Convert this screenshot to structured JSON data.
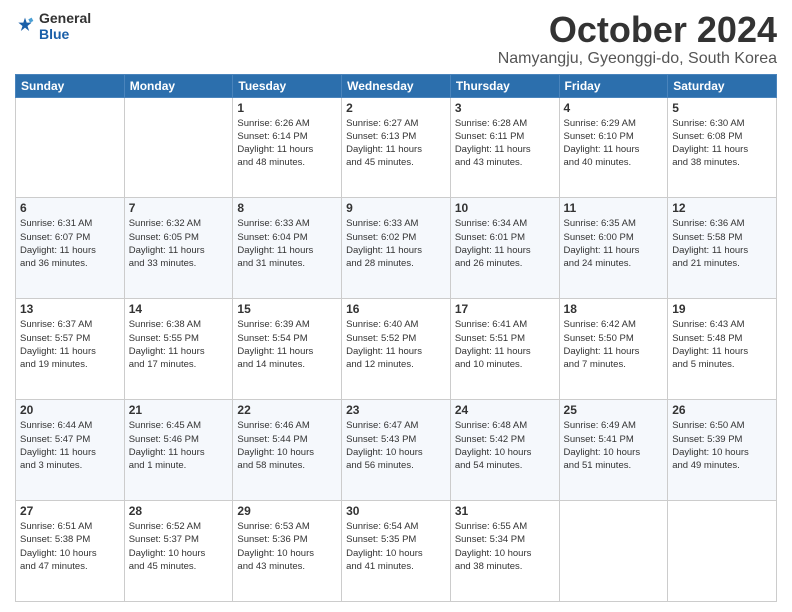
{
  "logo": {
    "general": "General",
    "blue": "Blue"
  },
  "header": {
    "title": "October 2024",
    "subtitle": "Namyangju, Gyeonggi-do, South Korea"
  },
  "weekdays": [
    "Sunday",
    "Monday",
    "Tuesday",
    "Wednesday",
    "Thursday",
    "Friday",
    "Saturday"
  ],
  "weeks": [
    [
      {
        "num": "",
        "info": ""
      },
      {
        "num": "",
        "info": ""
      },
      {
        "num": "1",
        "info": "Sunrise: 6:26 AM\nSunset: 6:14 PM\nDaylight: 11 hours\nand 48 minutes."
      },
      {
        "num": "2",
        "info": "Sunrise: 6:27 AM\nSunset: 6:13 PM\nDaylight: 11 hours\nand 45 minutes."
      },
      {
        "num": "3",
        "info": "Sunrise: 6:28 AM\nSunset: 6:11 PM\nDaylight: 11 hours\nand 43 minutes."
      },
      {
        "num": "4",
        "info": "Sunrise: 6:29 AM\nSunset: 6:10 PM\nDaylight: 11 hours\nand 40 minutes."
      },
      {
        "num": "5",
        "info": "Sunrise: 6:30 AM\nSunset: 6:08 PM\nDaylight: 11 hours\nand 38 minutes."
      }
    ],
    [
      {
        "num": "6",
        "info": "Sunrise: 6:31 AM\nSunset: 6:07 PM\nDaylight: 11 hours\nand 36 minutes."
      },
      {
        "num": "7",
        "info": "Sunrise: 6:32 AM\nSunset: 6:05 PM\nDaylight: 11 hours\nand 33 minutes."
      },
      {
        "num": "8",
        "info": "Sunrise: 6:33 AM\nSunset: 6:04 PM\nDaylight: 11 hours\nand 31 minutes."
      },
      {
        "num": "9",
        "info": "Sunrise: 6:33 AM\nSunset: 6:02 PM\nDaylight: 11 hours\nand 28 minutes."
      },
      {
        "num": "10",
        "info": "Sunrise: 6:34 AM\nSunset: 6:01 PM\nDaylight: 11 hours\nand 26 minutes."
      },
      {
        "num": "11",
        "info": "Sunrise: 6:35 AM\nSunset: 6:00 PM\nDaylight: 11 hours\nand 24 minutes."
      },
      {
        "num": "12",
        "info": "Sunrise: 6:36 AM\nSunset: 5:58 PM\nDaylight: 11 hours\nand 21 minutes."
      }
    ],
    [
      {
        "num": "13",
        "info": "Sunrise: 6:37 AM\nSunset: 5:57 PM\nDaylight: 11 hours\nand 19 minutes."
      },
      {
        "num": "14",
        "info": "Sunrise: 6:38 AM\nSunset: 5:55 PM\nDaylight: 11 hours\nand 17 minutes."
      },
      {
        "num": "15",
        "info": "Sunrise: 6:39 AM\nSunset: 5:54 PM\nDaylight: 11 hours\nand 14 minutes."
      },
      {
        "num": "16",
        "info": "Sunrise: 6:40 AM\nSunset: 5:52 PM\nDaylight: 11 hours\nand 12 minutes."
      },
      {
        "num": "17",
        "info": "Sunrise: 6:41 AM\nSunset: 5:51 PM\nDaylight: 11 hours\nand 10 minutes."
      },
      {
        "num": "18",
        "info": "Sunrise: 6:42 AM\nSunset: 5:50 PM\nDaylight: 11 hours\nand 7 minutes."
      },
      {
        "num": "19",
        "info": "Sunrise: 6:43 AM\nSunset: 5:48 PM\nDaylight: 11 hours\nand 5 minutes."
      }
    ],
    [
      {
        "num": "20",
        "info": "Sunrise: 6:44 AM\nSunset: 5:47 PM\nDaylight: 11 hours\nand 3 minutes."
      },
      {
        "num": "21",
        "info": "Sunrise: 6:45 AM\nSunset: 5:46 PM\nDaylight: 11 hours\nand 1 minute."
      },
      {
        "num": "22",
        "info": "Sunrise: 6:46 AM\nSunset: 5:44 PM\nDaylight: 10 hours\nand 58 minutes."
      },
      {
        "num": "23",
        "info": "Sunrise: 6:47 AM\nSunset: 5:43 PM\nDaylight: 10 hours\nand 56 minutes."
      },
      {
        "num": "24",
        "info": "Sunrise: 6:48 AM\nSunset: 5:42 PM\nDaylight: 10 hours\nand 54 minutes."
      },
      {
        "num": "25",
        "info": "Sunrise: 6:49 AM\nSunset: 5:41 PM\nDaylight: 10 hours\nand 51 minutes."
      },
      {
        "num": "26",
        "info": "Sunrise: 6:50 AM\nSunset: 5:39 PM\nDaylight: 10 hours\nand 49 minutes."
      }
    ],
    [
      {
        "num": "27",
        "info": "Sunrise: 6:51 AM\nSunset: 5:38 PM\nDaylight: 10 hours\nand 47 minutes."
      },
      {
        "num": "28",
        "info": "Sunrise: 6:52 AM\nSunset: 5:37 PM\nDaylight: 10 hours\nand 45 minutes."
      },
      {
        "num": "29",
        "info": "Sunrise: 6:53 AM\nSunset: 5:36 PM\nDaylight: 10 hours\nand 43 minutes."
      },
      {
        "num": "30",
        "info": "Sunrise: 6:54 AM\nSunset: 5:35 PM\nDaylight: 10 hours\nand 41 minutes."
      },
      {
        "num": "31",
        "info": "Sunrise: 6:55 AM\nSunset: 5:34 PM\nDaylight: 10 hours\nand 38 minutes."
      },
      {
        "num": "",
        "info": ""
      },
      {
        "num": "",
        "info": ""
      }
    ]
  ]
}
